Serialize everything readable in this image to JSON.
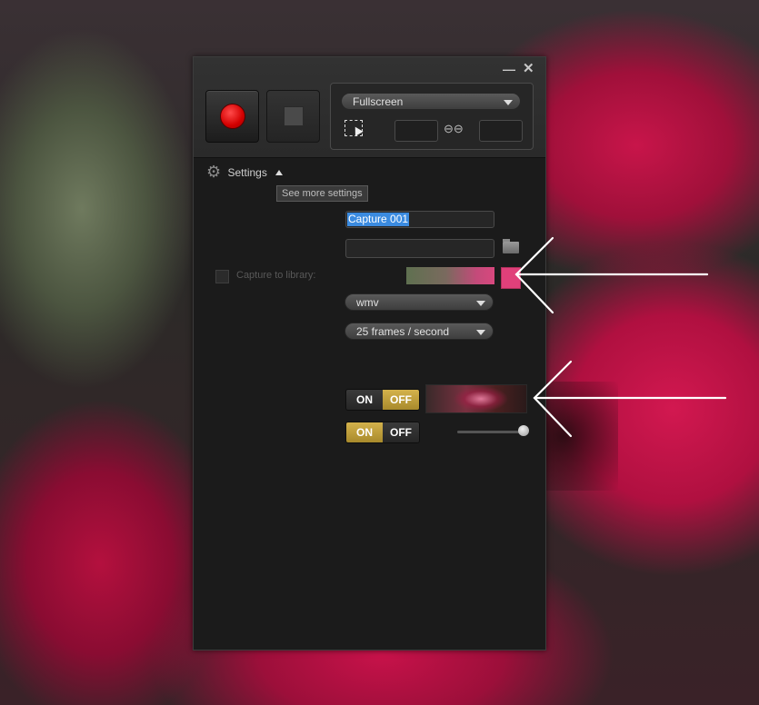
{
  "header": {
    "minimize_icon": "minimize-icon",
    "close_icon": "close-icon",
    "minimize_glyph": "—",
    "close_glyph": "✕"
  },
  "capture": {
    "record_icon": "record-icon",
    "stop_icon": "stop-icon",
    "mode": "Fullscreen",
    "region_icon": "region-select-icon",
    "lock_ratio_icon": "link-icon",
    "lock_ratio_glyph": "⊖⊖",
    "width_value": "",
    "height_value": ""
  },
  "settings": {
    "label": "Settings",
    "gear_glyph": "⚙",
    "tooltip": "See more settings",
    "file_name": "Capture 001",
    "save_path": "",
    "folder_icon": "folder-icon",
    "capture_to_library_label": "Capture to library:",
    "capture_to_library_checked": false,
    "highlight_color": "#e0407a",
    "format": "wmv",
    "frame_rate": "25 frames / second",
    "toggle1": {
      "on_label": "ON",
      "off_label": "OFF",
      "state": "off"
    },
    "toggle2": {
      "on_label": "ON",
      "off_label": "OFF",
      "state": "on"
    },
    "slider_value": 1.0
  },
  "colors": {
    "accent_gold": "#c9a43f",
    "record_red": "#d30000",
    "selection_blue": "#3b8be0"
  }
}
